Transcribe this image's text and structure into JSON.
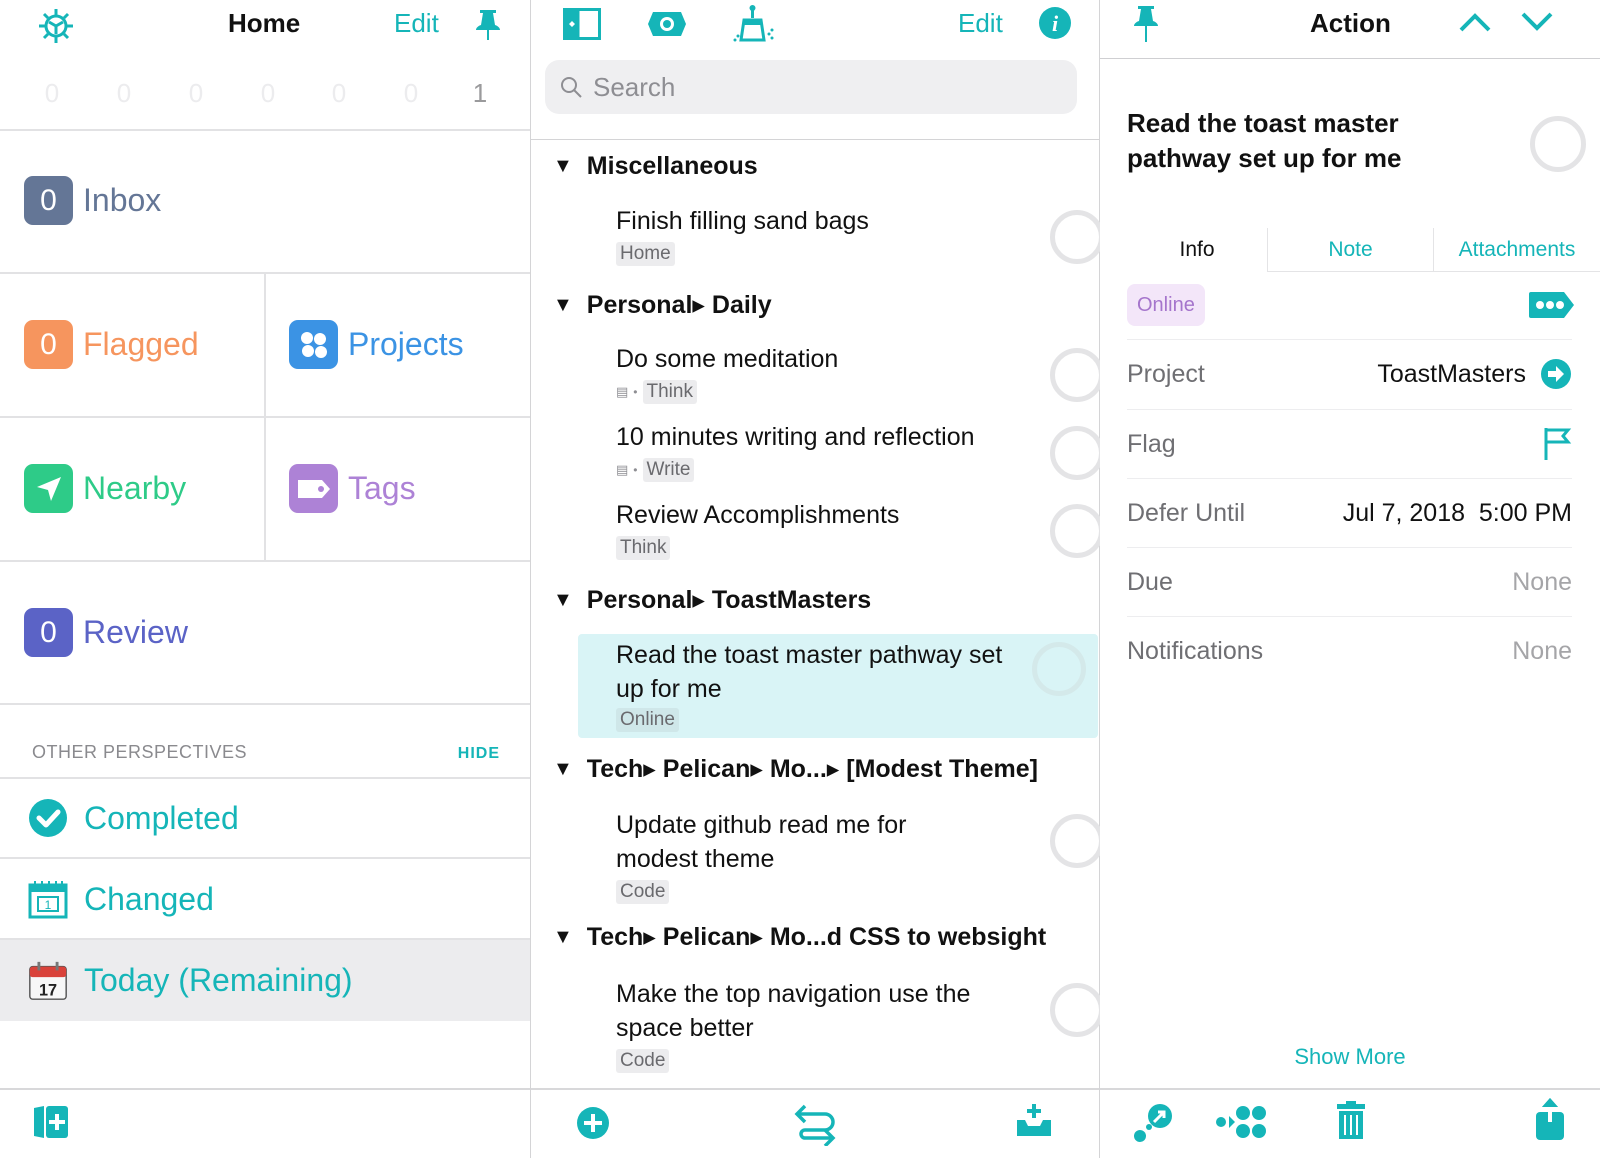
{
  "left": {
    "header": {
      "title": "Home",
      "edit_label": "Edit",
      "settings_icon": "gear-icon",
      "pin_icon": "pin-icon"
    },
    "forecast_counts": [
      "0",
      "0",
      "0",
      "0",
      "0",
      "0",
      "1"
    ],
    "perspectives": {
      "inbox": {
        "count": "0",
        "label": "Inbox",
        "color": "#647696"
      },
      "flagged": {
        "count": "0",
        "label": "Flagged",
        "color": "#f6955e"
      },
      "projects": {
        "label": "Projects",
        "color": "#3b93e4",
        "icon": "projects-dots-icon"
      },
      "nearby": {
        "label": "Nearby",
        "color": "#2ecb88",
        "icon": "location-arrow-icon"
      },
      "tags": {
        "label": "Tags",
        "color": "#ad82d6",
        "icon": "tag-icon"
      },
      "review": {
        "count": "0",
        "label": "Review",
        "color": "#5b63c6"
      }
    },
    "other_perspectives": {
      "header": "OTHER PERSPECTIVES",
      "hide_label": "HIDE",
      "items": [
        {
          "label": "Completed",
          "icon": "checkmark-circle-icon"
        },
        {
          "label": "Changed",
          "icon": "calendar-icon",
          "icon_text": "1"
        },
        {
          "label": "Today (Remaining)",
          "icon": "calendar-color-icon",
          "icon_text": "17",
          "selected": true
        }
      ]
    },
    "toolbar": {
      "new_perspective_icon": "add-sidebar-icon"
    }
  },
  "middle": {
    "toolbar": {
      "sidebar_icon": "sidebar-toggle-icon",
      "view_icon": "view-options-icon",
      "cleanup_icon": "broom-icon",
      "edit_label": "Edit",
      "info_icon": "info-icon"
    },
    "search": {
      "placeholder": "Search",
      "value": ""
    },
    "groups": [
      {
        "title": "Miscellaneous",
        "tasks": [
          {
            "title": "Finish filling sand bags",
            "tag": "Home",
            "has_note": false
          }
        ]
      },
      {
        "title": "Personal▸ Daily",
        "tasks": [
          {
            "title": "Do some meditation",
            "tag": "Think",
            "has_note": true
          },
          {
            "title": "10 minutes writing and reflection",
            "tag": "Write",
            "has_note": true
          },
          {
            "title": "Review Accomplishments",
            "tag": "Think",
            "has_note": false
          }
        ]
      },
      {
        "title": "Personal▸ ToastMasters",
        "tasks": [
          {
            "title": "Read the toast master pathway set up for me",
            "tag": "Online",
            "has_note": false,
            "selected": true
          }
        ]
      },
      {
        "title": "Tech▸ Pelican▸ Mo...▸ [Modest Theme]",
        "tasks": [
          {
            "title": "Update github read me for modest theme",
            "tag": "Code",
            "has_note": false
          }
        ]
      },
      {
        "title": "Tech▸ Pelican▸ Mo...d CSS to websight",
        "tasks": [
          {
            "title": "Make the top navigation use the space better",
            "tag": "Code",
            "has_note": false
          }
        ]
      }
    ],
    "bottom_toolbar": {
      "add_icon": "add-circle-icon",
      "sync_icon": "sync-arrows-icon",
      "inbox_add_icon": "quick-entry-icon"
    }
  },
  "right": {
    "header": {
      "title": "Action",
      "pin_icon": "pin-icon",
      "prev_icon": "chevron-up-icon",
      "next_icon": "chevron-down-icon"
    },
    "task_title": "Read the toast master pathway set up for me",
    "tabs": [
      {
        "label": "Info",
        "active": true
      },
      {
        "label": "Note",
        "active": false
      },
      {
        "label": "Attachments",
        "active": false
      }
    ],
    "tag": "Online",
    "fields": [
      {
        "key": "Project",
        "value": "ToastMasters"
      },
      {
        "key": "Flag",
        "value": ""
      },
      {
        "key": "Defer Until",
        "value": "Jul 7, 2018  5:00 PM"
      },
      {
        "key": "Due",
        "value": "None"
      },
      {
        "key": "Notifications",
        "value": "None"
      }
    ],
    "show_more_label": "Show More",
    "bottom_toolbar": {
      "focus_icon": "focus-icon",
      "move_icon": "move-to-project-icon",
      "delete_icon": "trash-icon",
      "share_icon": "share-icon"
    }
  },
  "colors": {
    "accent": "#15b5b8",
    "selected_row": "#d9f4f6",
    "selected_perspective": "#ececee"
  }
}
